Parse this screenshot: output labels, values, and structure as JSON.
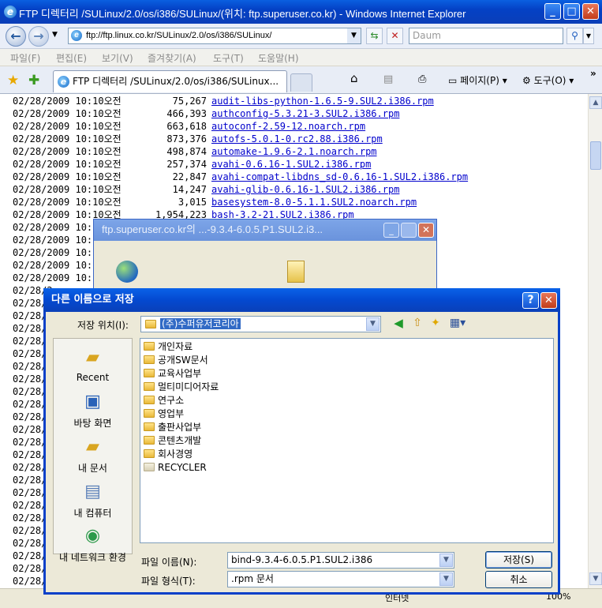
{
  "browser": {
    "title": "FTP 디렉터리 /SULinux/2.0/os/i386/SULinux/(위치: ftp.superuser.co.kr) - Windows Internet Explorer",
    "address": "ftp://ftp.linux.co.kr/SULinux/2.0/os/i386/SULinux/",
    "search_placeholder": "Daum",
    "menu": [
      "파일(F)",
      "편집(E)",
      "보기(V)",
      "즐겨찾기(A)",
      "도구(T)",
      "도움말(H)"
    ],
    "tab_title": "FTP 디렉터리 /SULinux/2.0/os/i386/SULinux...",
    "page_label": "페이지(P)",
    "tools_label": "도구(O)",
    "status_zone": "인터넷",
    "zoom": "100%"
  },
  "listing": [
    {
      "date": "02/28/2009 10:10오전",
      "size": "75,267",
      "file": "audit-libs-python-1.6.5-9.SUL2.i386.rpm"
    },
    {
      "date": "02/28/2009 10:10오전",
      "size": "466,393",
      "file": "authconfig-5.3.21-3.SUL2.i386.rpm"
    },
    {
      "date": "02/28/2009 10:10오전",
      "size": "663,618",
      "file": "autoconf-2.59-12.noarch.rpm"
    },
    {
      "date": "02/28/2009 10:10오전",
      "size": "873,376",
      "file": "autofs-5.0.1-0.rc2.88.i386.rpm"
    },
    {
      "date": "02/28/2009 10:10오전",
      "size": "498,874",
      "file": "automake-1.9.6-2.1.noarch.rpm"
    },
    {
      "date": "02/28/2009 10:10오전",
      "size": "257,374",
      "file": "avahi-0.6.16-1.SUL2.i386.rpm"
    },
    {
      "date": "02/28/2009 10:10오전",
      "size": "22,847",
      "file": "avahi-compat-libdns_sd-0.6.16-1.SUL2.i386.rpm"
    },
    {
      "date": "02/28/2009 10:10오전",
      "size": "14,247",
      "file": "avahi-glib-0.6.16-1.SUL2.i386.rpm"
    },
    {
      "date": "02/28/2009 10:10오전",
      "size": "3,015",
      "file": "basesystem-8.0-5.1.1.SUL2.noarch.rpm"
    },
    {
      "date": "02/28/2009 10:10오전",
      "size": "1,954,223",
      "file": "bash-3.2-21.SUL2.i386.rpm"
    }
  ],
  "partial_rows": [
    "02/28/2009 10:1",
    "02/28/2009 10:1",
    "02/28/2009 10:1",
    "02/28/2009 10:1",
    "02/28/2009 10:1",
    "02/28/2",
    "02/28/",
    "02/28/",
    "02/28/",
    "02/28/",
    "02/28/",
    "02/28/",
    "02/28/",
    "02/28/",
    "02/28/",
    "02/28/",
    "02/28/",
    "02/28/",
    "02/28/",
    "02/28/",
    "02/28/",
    "02/28/",
    "02/28/",
    "02/28/",
    "02/28/",
    "02/28/",
    "02/28/",
    "02/28/",
    "02/28/"
  ],
  "download_dialog": {
    "title": "ftp.superuser.co.kr의 ...-9.3.4-6.0.5.P1.SUL2.i3..."
  },
  "save_dialog": {
    "title": "다른 이름으로 저장",
    "save_in_label": "저장 위치(I):",
    "save_in_value": "(주)수퍼유저코리아",
    "places": [
      "Recent",
      "바탕 화면",
      "내 문서",
      "내 컴퓨터",
      "내 네트워크 환경"
    ],
    "folders": [
      "개인자료",
      "공개SW문서",
      "교육사업부",
      "멀티미디어자료",
      "연구소",
      "영업부",
      "출판사업부",
      "콘텐츠개발",
      "회사경영",
      "RECYCLER"
    ],
    "filename_label": "파일 이름(N):",
    "filename_value": "bind-9.3.4-6.0.5.P1.SUL2.i386",
    "filetype_label": "파일 형식(T):",
    "filetype_value": ".rpm 문서",
    "save_button": "저장(S)",
    "cancel_button": "취소"
  }
}
